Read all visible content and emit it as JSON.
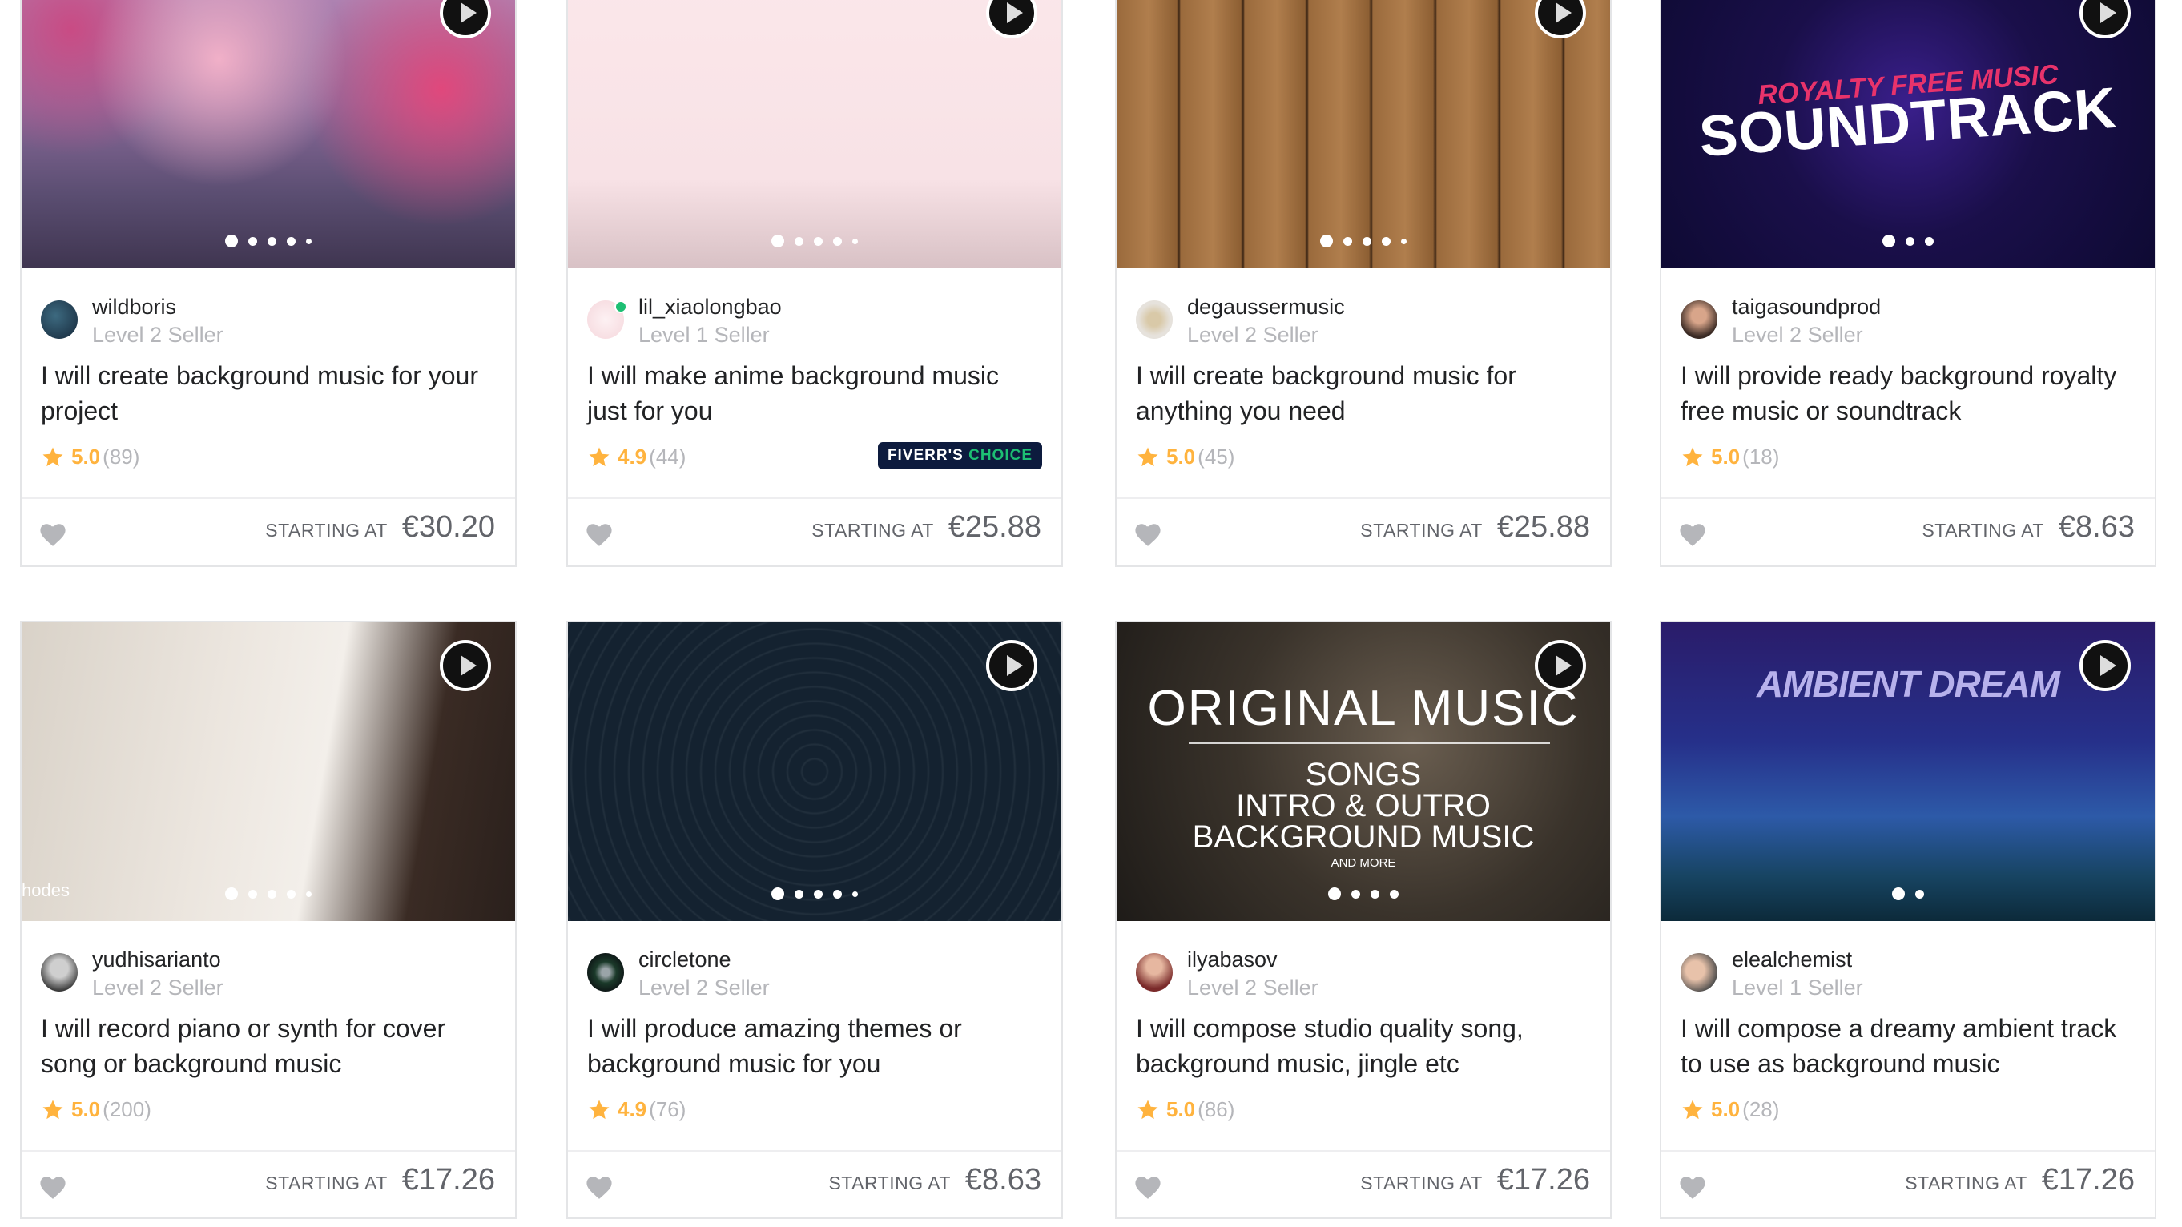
{
  "labels": {
    "starting_at": "STARTING AT",
    "badge_prefix": "FIVERR'S",
    "badge_accent": "CHOICE"
  },
  "colors": {
    "rating": "#ffb33e",
    "online": "#1dbf73",
    "badge_bg": "#0d1b3e",
    "badge_accent": "#1dbf73",
    "muted": "#b5b6ba",
    "price": "#62646a"
  },
  "gigs": [
    {
      "seller": "wildboris",
      "level": "Level 2 Seller",
      "title": "I will create background music for your project",
      "rating": "5.0",
      "reviews": "(89)",
      "price": "€30.20",
      "slides": 5,
      "online": false,
      "fivers_choice": false,
      "thumb_text": []
    },
    {
      "seller": "lil_xiaolongbao",
      "level": "Level 1 Seller",
      "title": "I will make anime background music just for you",
      "rating": "4.9",
      "reviews": "(44)",
      "price": "€25.88",
      "slides": 5,
      "online": true,
      "fivers_choice": true,
      "thumb_text": []
    },
    {
      "seller": "degaussermusic",
      "level": "Level 2 Seller",
      "title": "I will create background music for anything you need",
      "rating": "5.0",
      "reviews": "(45)",
      "price": "€25.88",
      "slides": 5,
      "online": false,
      "fivers_choice": false,
      "thumb_text": []
    },
    {
      "seller": "taigasoundprod",
      "level": "Level 2 Seller",
      "title": "I will provide ready background royalty free music or soundtrack",
      "rating": "5.0",
      "reviews": "(18)",
      "price": "€8.63",
      "slides": 3,
      "online": false,
      "fivers_choice": false,
      "thumb_text": [
        "ROYALTY FREE MUSIC",
        "SOUNDTRACK"
      ]
    },
    {
      "seller": "yudhisarianto",
      "level": "Level 2 Seller",
      "title": "I will record piano or synth for cover song or background music",
      "rating": "5.0",
      "reviews": "(200)",
      "price": "€17.26",
      "slides": 5,
      "online": false,
      "fivers_choice": false,
      "thumb_text": [
        "hodes"
      ]
    },
    {
      "seller": "circletone",
      "level": "Level 2 Seller",
      "title": "I will produce amazing themes or background music for you",
      "rating": "4.9",
      "reviews": "(76)",
      "price": "€8.63",
      "slides": 5,
      "online": false,
      "fivers_choice": false,
      "thumb_text": []
    },
    {
      "seller": "ilyabasov",
      "level": "Level 2 Seller",
      "title": "I will compose studio quality song, background music, jingle etc",
      "rating": "5.0",
      "reviews": "(86)",
      "price": "€17.26",
      "slides": 4,
      "online": false,
      "fivers_choice": false,
      "thumb_text": [
        "ORIGINAL MUSIC",
        "SONGS",
        "INTRO & OUTRO",
        "BACKGROUND MUSIC",
        "AND MORE"
      ]
    },
    {
      "seller": "elealchemist",
      "level": "Level 1 Seller",
      "title": "I will compose a dreamy ambient track to use as background music",
      "rating": "5.0",
      "reviews": "(28)",
      "price": "€17.26",
      "slides": 2,
      "online": false,
      "fivers_choice": false,
      "thumb_text": [
        "AMBIENT DREAM"
      ]
    }
  ]
}
